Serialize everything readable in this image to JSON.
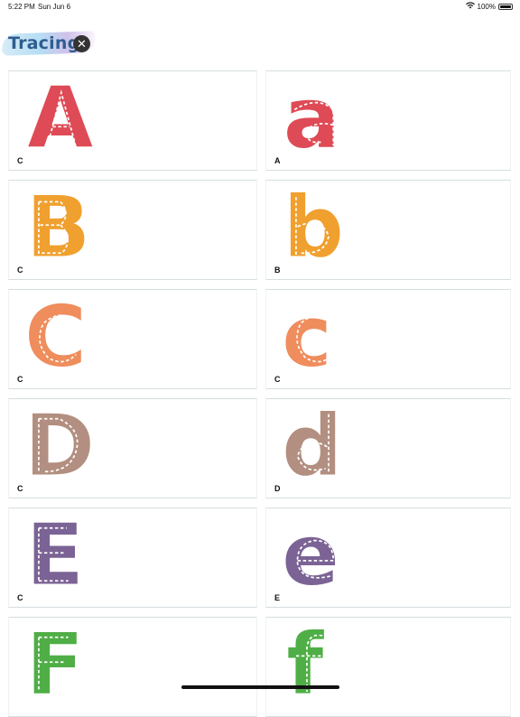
{
  "status_bar": {
    "time": "5:22 PM",
    "date": "Sun Jun 6",
    "battery": "100%"
  },
  "header": {
    "title": "Tracing",
    "close_icon": "close-icon"
  },
  "colors": {
    "red": "#de4a55",
    "orange": "#f0a02f",
    "salmon": "#ef8d5c",
    "mauve": "#b28f80",
    "purple": "#7b6395",
    "green": "#4fae45"
  },
  "cards": [
    {
      "glyph": "A",
      "label": "C",
      "color": "#de4a55"
    },
    {
      "glyph": "a",
      "label": "A",
      "color": "#de4a55"
    },
    {
      "glyph": "B",
      "label": "C",
      "color": "#f0a02f"
    },
    {
      "glyph": "b",
      "label": "B",
      "color": "#f0a02f"
    },
    {
      "glyph": "C",
      "label": "C",
      "color": "#ef8d5c"
    },
    {
      "glyph": "c",
      "label": "C",
      "color": "#ef8d5c"
    },
    {
      "glyph": "D",
      "label": "C",
      "color": "#b28f80"
    },
    {
      "glyph": "d",
      "label": "D",
      "color": "#b28f80"
    },
    {
      "glyph": "E",
      "label": "C",
      "color": "#7b6395"
    },
    {
      "glyph": "e",
      "label": "E",
      "color": "#7b6395"
    },
    {
      "glyph": "F",
      "label": "",
      "color": "#4fae45"
    },
    {
      "glyph": "f",
      "label": "",
      "color": "#4fae45"
    }
  ]
}
